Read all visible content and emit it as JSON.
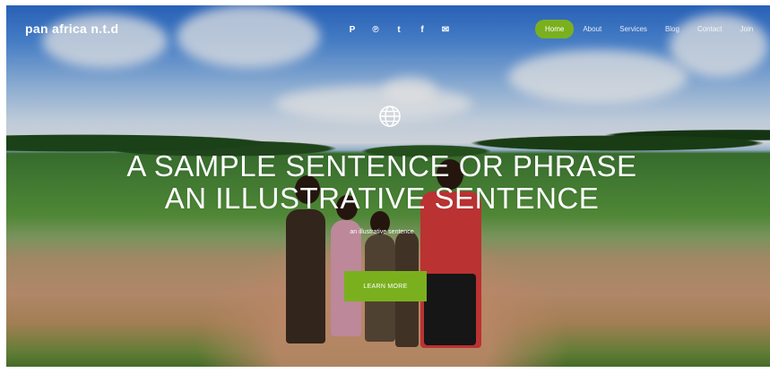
{
  "brand": {
    "logo_text": "pan africa n.t.d"
  },
  "social": [
    {
      "icon": "pinterest-icon",
      "glyph": "P"
    },
    {
      "icon": "pinterest-icon",
      "glyph": "℗"
    },
    {
      "icon": "twitter-icon",
      "glyph": "t"
    },
    {
      "icon": "facebook-icon",
      "glyph": "f"
    },
    {
      "icon": "email-icon",
      "glyph": "✉"
    }
  ],
  "nav": {
    "items": [
      "Home",
      "About",
      "Services",
      "Blog",
      "Contact",
      "Join"
    ],
    "active": "Home"
  },
  "hero": {
    "headline_line1": "A SAMPLE SENTENCE OR PHRASE",
    "headline_line2": "AN ILLUSTRATIVE SENTENCE",
    "subtext": "an illustrative sentence",
    "cta_label": "LEARN MORE",
    "globe_icon": "globe-icon"
  },
  "colors": {
    "accent": "#7ab01e"
  }
}
